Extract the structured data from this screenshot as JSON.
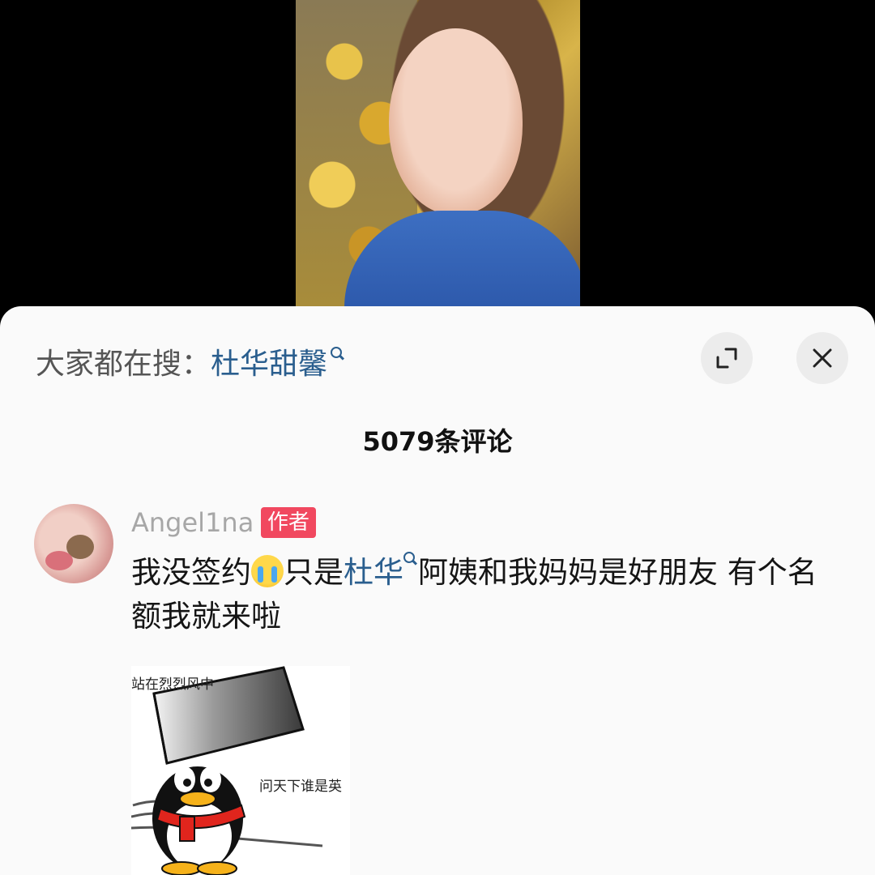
{
  "search": {
    "prefix": "大家都在搜：",
    "query": "杜华甜馨"
  },
  "comments": {
    "count_label": "5079条评论"
  },
  "comment": {
    "username": "Angel1na",
    "badge": "作者",
    "text_part1": "我没签约",
    "text_part2": "只是",
    "mention": "杜华",
    "text_part3": "阿姨和我妈妈是好朋友 有个名额我就来啦"
  },
  "sticker": {
    "top_caption": "站在烈烈风中",
    "side_caption": "问天下谁是英"
  },
  "colors": {
    "accent_link": "#2a5e8e",
    "author_badge": "#f1485f"
  }
}
